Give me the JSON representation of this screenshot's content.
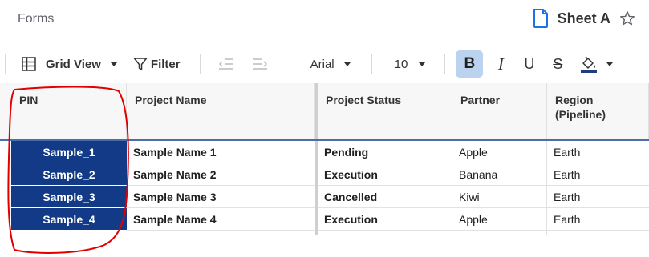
{
  "header": {
    "breadcrumb": "Forms",
    "sheet_name": "Sheet A"
  },
  "toolbar": {
    "view_label": "Grid View",
    "filter_label": "Filter",
    "font_family": "Arial",
    "font_size": "10",
    "bold_label": "B",
    "italic_label": "I",
    "underline_label": "U",
    "strike_label": "S",
    "fill_color": "#1f3f7a"
  },
  "table": {
    "columns": [
      "PIN",
      "Project Name",
      "Project Status",
      "Partner",
      "Region\n(Pipeline)"
    ],
    "rows": [
      {
        "pin": "Sample_1",
        "name": "Sample Name 1",
        "status": "Pending",
        "partner": "Apple",
        "region": "Earth"
      },
      {
        "pin": "Sample_2",
        "name": "Sample Name 2",
        "status": "Execution",
        "partner": "Banana",
        "region": "Earth"
      },
      {
        "pin": "Sample_3",
        "name": "Sample Name 3",
        "status": "Cancelled",
        "partner": "Kiwi",
        "region": "Earth"
      },
      {
        "pin": "Sample_4",
        "name": "Sample Name 4",
        "status": "Execution",
        "partner": "Apple",
        "region": "Earth"
      }
    ]
  },
  "colors": {
    "pin_fill": "#123a87",
    "bold_active": "#bcd3ef",
    "annotation": "#e00000"
  }
}
